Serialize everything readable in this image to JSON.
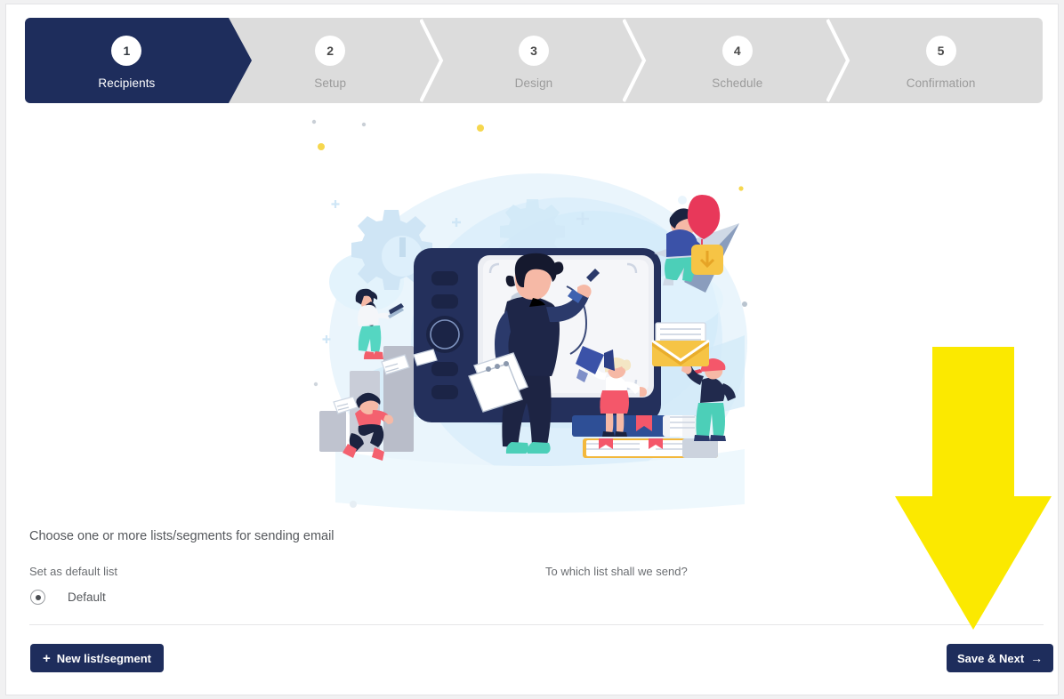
{
  "app": {
    "accent_dark": "#1e2d5c",
    "step_inactive_bg": "#dcdcdc",
    "annotation_color": "#fbe900"
  },
  "stepper": {
    "steps": [
      {
        "number": "1",
        "label": "Recipients",
        "active": true
      },
      {
        "number": "2",
        "label": "Setup",
        "active": false
      },
      {
        "number": "3",
        "label": "Design",
        "active": false
      },
      {
        "number": "4",
        "label": "Schedule",
        "active": false
      },
      {
        "number": "5",
        "label": "Confirmation",
        "active": false
      }
    ]
  },
  "illustration": {
    "alt": "flat illustration of people around a large drawing tablet, charts, envelope, books, paper plane and balloon"
  },
  "main": {
    "lead": "Choose one or more lists/segments for sending email",
    "left_column_label": "Set as default list",
    "right_column_label": "To which list shall we send?",
    "lists": [
      {
        "name": "Default",
        "selected": true
      }
    ]
  },
  "footer": {
    "new_list_plus": "+",
    "new_list_label": "New list/segment",
    "save_next_label": "Save & Next",
    "save_next_arrow": "→"
  },
  "annotation": {
    "type": "down-arrow",
    "points_to": "Save & Next"
  }
}
